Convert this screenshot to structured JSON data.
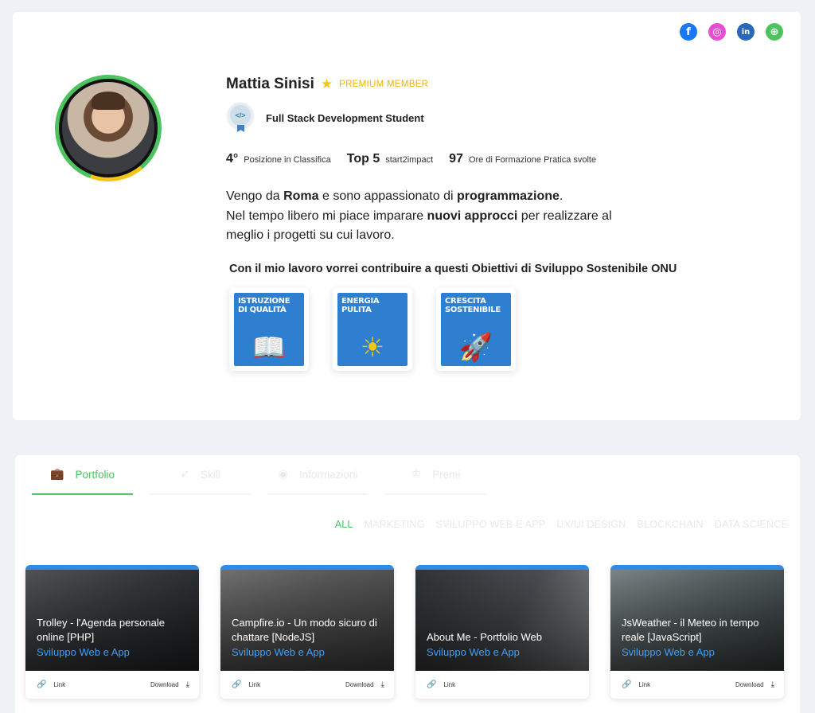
{
  "profile": {
    "name": "Mattia Sinisi",
    "membership": "PREMIUM MEMBER",
    "role": "Full Stack Development Student",
    "stats": [
      {
        "value": "4°",
        "label": "Posizione in Classifica"
      },
      {
        "value": "Top 5",
        "label": "start2impact"
      },
      {
        "value": "97",
        "label": "Ore di Formazione Pratica svolte"
      }
    ],
    "bio": {
      "line1_a": "Vengo da ",
      "line1_b": "Roma",
      "line1_c": " e sono appassionato di ",
      "line1_d": "programmazione",
      "line1_e": ".",
      "line2_a": "Nel tempo libero mi piace imparare ",
      "line2_b": "nuovi approcci",
      "line2_c": " per realizzare al",
      "line3": "meglio i progetti su cui lavoro."
    },
    "goals_title": "Con il mio lavoro vorrei contribuire a questi Obiettivi di Sviluppo Sostenibile ONU",
    "goals": [
      {
        "label": "ISTRUZIONE\nDI QUALITÀ",
        "icon": "book-icon",
        "glyph": "📖"
      },
      {
        "label": "ENERGIA\nPULITA",
        "icon": "sun-icon",
        "glyph": "☀"
      },
      {
        "label": "CRESCITA\nSOSTENIBILE",
        "icon": "rocket-icon",
        "glyph": "🚀"
      }
    ],
    "socials": [
      "facebook-icon",
      "instagram-icon",
      "linkedin-icon",
      "website-icon"
    ]
  },
  "tabs": [
    {
      "label": "Portfolio",
      "icon": "briefcase-icon"
    },
    {
      "label": "Skill",
      "icon": "rocket-icon"
    },
    {
      "label": "Informazioni",
      "icon": "user-circle-icon"
    },
    {
      "label": "Premi",
      "icon": "award-icon"
    }
  ],
  "filters": [
    "ALL",
    "MARKETING",
    "SVILUPPO WEB E APP",
    "UX/UI DESIGN",
    "BLOCKCHAIN",
    "DATA SCIENCE"
  ],
  "projects": [
    {
      "title": "Trolley - l'Agenda personale online [PHP]",
      "category": "Sviluppo Web e App",
      "link": "Link",
      "download": "Download"
    },
    {
      "title": "Campfire.io - Un modo sicuro di chattare [NodeJS]",
      "category": "Sviluppo Web e App",
      "link": "Link",
      "download": "Download"
    },
    {
      "title": "About Me - Portfolio Web",
      "category": "Sviluppo Web e App",
      "link": "Link",
      "download": ""
    },
    {
      "title": "JsWeather - il Meteo in tempo reale [JavaScript]",
      "category": "Sviluppo Web e App",
      "link": "Link",
      "download": "Download"
    }
  ],
  "colors": {
    "accent": "#4cc35f",
    "premium": "#f0b400",
    "link": "#3aa0ff",
    "project_top": "#2f8be6"
  }
}
